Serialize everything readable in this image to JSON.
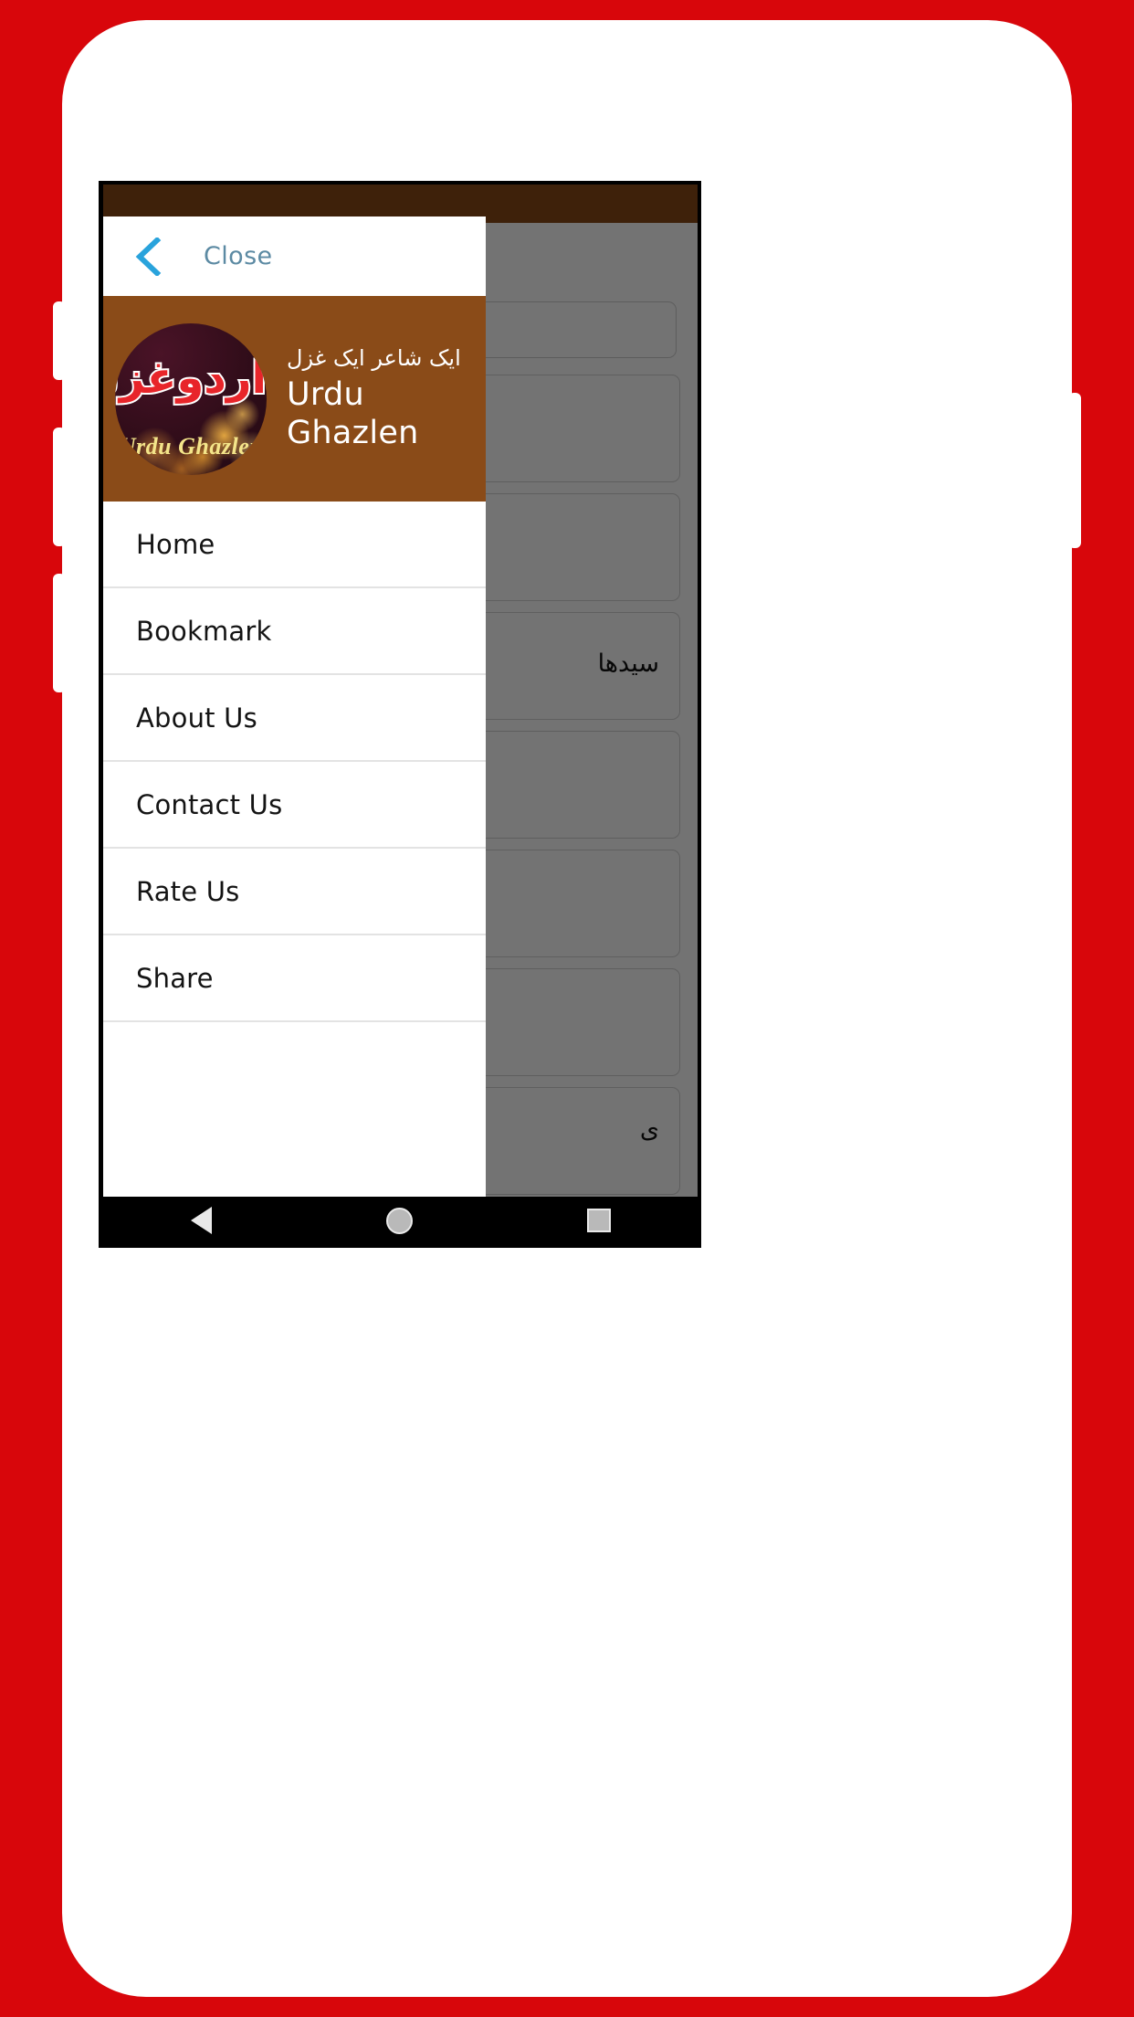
{
  "backdrop": {
    "color": "#d8060b"
  },
  "device": {
    "frame_color": "#ffffff",
    "screen_bezel_color": "#000000"
  },
  "app": {
    "toolbar_color": "#8a4b18",
    "background_cards": [
      {
        "text": ""
      },
      {
        "text": ""
      },
      {
        "text": "سیدھا"
      },
      {
        "text": ""
      },
      {
        "text": ""
      },
      {
        "text": ""
      },
      {
        "text": "ی"
      }
    ]
  },
  "drawer": {
    "close": {
      "label": "Close",
      "icon": "chevron-left-icon",
      "color": "#5c8aa3"
    },
    "brand": {
      "header_color": "#8a4b18",
      "logo_script": "اردوغزلیں",
      "logo_latin": "Urdu Ghazlen",
      "tagline_urdu": "ایک شاعر ایک غزل",
      "title_line1": "Urdu",
      "title_line2": "Ghazlen"
    },
    "menu": [
      {
        "label": "Home"
      },
      {
        "label": "Bookmark"
      },
      {
        "label": "About Us"
      },
      {
        "label": "Contact Us"
      },
      {
        "label": "Rate Us"
      },
      {
        "label": "Share"
      }
    ]
  },
  "nav_bar": {
    "back": "back-triangle-icon",
    "home": "home-circle-icon",
    "recent": "recent-square-icon"
  }
}
